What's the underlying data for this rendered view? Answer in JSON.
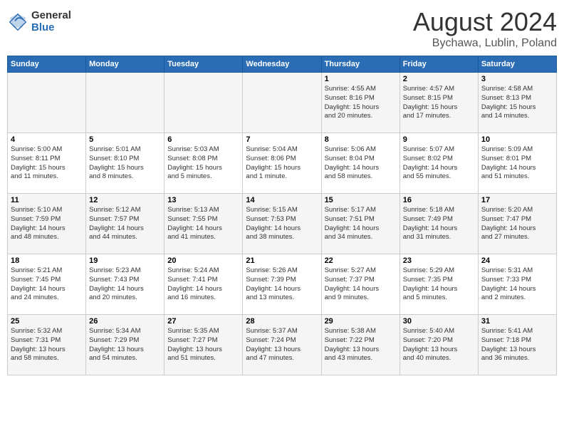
{
  "logo": {
    "general": "General",
    "blue": "Blue"
  },
  "title": "August 2024",
  "location": "Bychawa, Lublin, Poland",
  "headers": [
    "Sunday",
    "Monday",
    "Tuesday",
    "Wednesday",
    "Thursday",
    "Friday",
    "Saturday"
  ],
  "weeks": [
    [
      {
        "day": "",
        "info": ""
      },
      {
        "day": "",
        "info": ""
      },
      {
        "day": "",
        "info": ""
      },
      {
        "day": "",
        "info": ""
      },
      {
        "day": "1",
        "info": "Sunrise: 4:55 AM\nSunset: 8:16 PM\nDaylight: 15 hours\nand 20 minutes."
      },
      {
        "day": "2",
        "info": "Sunrise: 4:57 AM\nSunset: 8:15 PM\nDaylight: 15 hours\nand 17 minutes."
      },
      {
        "day": "3",
        "info": "Sunrise: 4:58 AM\nSunset: 8:13 PM\nDaylight: 15 hours\nand 14 minutes."
      }
    ],
    [
      {
        "day": "4",
        "info": "Sunrise: 5:00 AM\nSunset: 8:11 PM\nDaylight: 15 hours\nand 11 minutes."
      },
      {
        "day": "5",
        "info": "Sunrise: 5:01 AM\nSunset: 8:10 PM\nDaylight: 15 hours\nand 8 minutes."
      },
      {
        "day": "6",
        "info": "Sunrise: 5:03 AM\nSunset: 8:08 PM\nDaylight: 15 hours\nand 5 minutes."
      },
      {
        "day": "7",
        "info": "Sunrise: 5:04 AM\nSunset: 8:06 PM\nDaylight: 15 hours\nand 1 minute."
      },
      {
        "day": "8",
        "info": "Sunrise: 5:06 AM\nSunset: 8:04 PM\nDaylight: 14 hours\nand 58 minutes."
      },
      {
        "day": "9",
        "info": "Sunrise: 5:07 AM\nSunset: 8:02 PM\nDaylight: 14 hours\nand 55 minutes."
      },
      {
        "day": "10",
        "info": "Sunrise: 5:09 AM\nSunset: 8:01 PM\nDaylight: 14 hours\nand 51 minutes."
      }
    ],
    [
      {
        "day": "11",
        "info": "Sunrise: 5:10 AM\nSunset: 7:59 PM\nDaylight: 14 hours\nand 48 minutes."
      },
      {
        "day": "12",
        "info": "Sunrise: 5:12 AM\nSunset: 7:57 PM\nDaylight: 14 hours\nand 44 minutes."
      },
      {
        "day": "13",
        "info": "Sunrise: 5:13 AM\nSunset: 7:55 PM\nDaylight: 14 hours\nand 41 minutes."
      },
      {
        "day": "14",
        "info": "Sunrise: 5:15 AM\nSunset: 7:53 PM\nDaylight: 14 hours\nand 38 minutes."
      },
      {
        "day": "15",
        "info": "Sunrise: 5:17 AM\nSunset: 7:51 PM\nDaylight: 14 hours\nand 34 minutes."
      },
      {
        "day": "16",
        "info": "Sunrise: 5:18 AM\nSunset: 7:49 PM\nDaylight: 14 hours\nand 31 minutes."
      },
      {
        "day": "17",
        "info": "Sunrise: 5:20 AM\nSunset: 7:47 PM\nDaylight: 14 hours\nand 27 minutes."
      }
    ],
    [
      {
        "day": "18",
        "info": "Sunrise: 5:21 AM\nSunset: 7:45 PM\nDaylight: 14 hours\nand 24 minutes."
      },
      {
        "day": "19",
        "info": "Sunrise: 5:23 AM\nSunset: 7:43 PM\nDaylight: 14 hours\nand 20 minutes."
      },
      {
        "day": "20",
        "info": "Sunrise: 5:24 AM\nSunset: 7:41 PM\nDaylight: 14 hours\nand 16 minutes."
      },
      {
        "day": "21",
        "info": "Sunrise: 5:26 AM\nSunset: 7:39 PM\nDaylight: 14 hours\nand 13 minutes."
      },
      {
        "day": "22",
        "info": "Sunrise: 5:27 AM\nSunset: 7:37 PM\nDaylight: 14 hours\nand 9 minutes."
      },
      {
        "day": "23",
        "info": "Sunrise: 5:29 AM\nSunset: 7:35 PM\nDaylight: 14 hours\nand 5 minutes."
      },
      {
        "day": "24",
        "info": "Sunrise: 5:31 AM\nSunset: 7:33 PM\nDaylight: 14 hours\nand 2 minutes."
      }
    ],
    [
      {
        "day": "25",
        "info": "Sunrise: 5:32 AM\nSunset: 7:31 PM\nDaylight: 13 hours\nand 58 minutes."
      },
      {
        "day": "26",
        "info": "Sunrise: 5:34 AM\nSunset: 7:29 PM\nDaylight: 13 hours\nand 54 minutes."
      },
      {
        "day": "27",
        "info": "Sunrise: 5:35 AM\nSunset: 7:27 PM\nDaylight: 13 hours\nand 51 minutes."
      },
      {
        "day": "28",
        "info": "Sunrise: 5:37 AM\nSunset: 7:24 PM\nDaylight: 13 hours\nand 47 minutes."
      },
      {
        "day": "29",
        "info": "Sunrise: 5:38 AM\nSunset: 7:22 PM\nDaylight: 13 hours\nand 43 minutes."
      },
      {
        "day": "30",
        "info": "Sunrise: 5:40 AM\nSunset: 7:20 PM\nDaylight: 13 hours\nand 40 minutes."
      },
      {
        "day": "31",
        "info": "Sunrise: 5:41 AM\nSunset: 7:18 PM\nDaylight: 13 hours\nand 36 minutes."
      }
    ]
  ]
}
